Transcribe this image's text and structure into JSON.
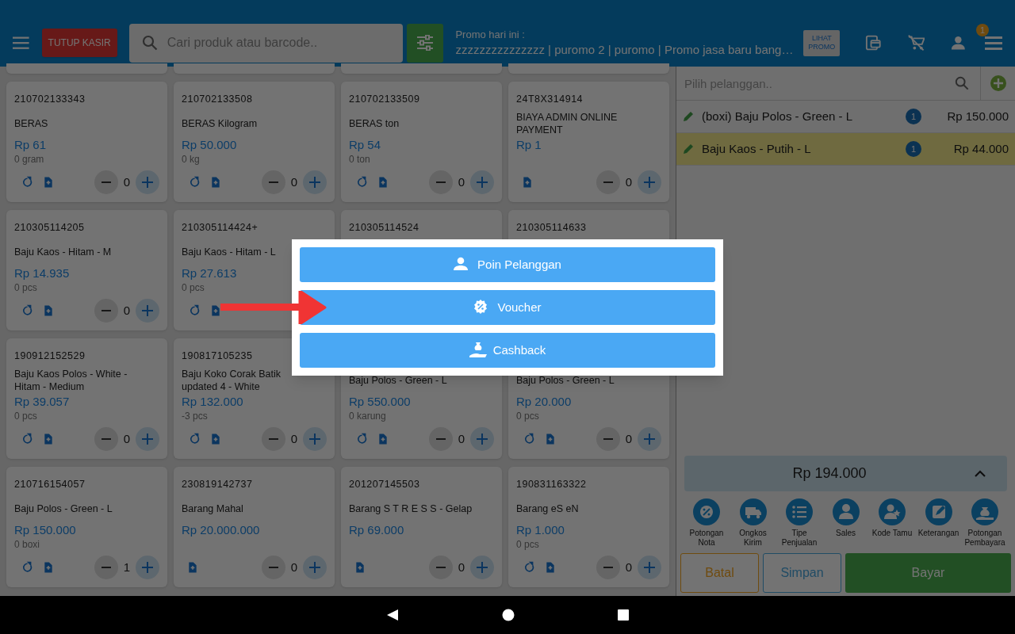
{
  "header": {
    "cashier_button": "TUTUP KASIR",
    "search": {
      "placeholder": "Cari produk atau barcode.."
    },
    "promo_label": "Promo hari ini :",
    "promo_text": "zzzzzzzzzzzzzzz | puromo 2 | puromo | Promo jasa baru bang…",
    "promo_button": "LIHAT PROMO",
    "notification_count": "1"
  },
  "products": [
    {
      "code": "210702133343",
      "name": "BERAS",
      "price": "Rp 61",
      "stock": "0 gram",
      "qty": "0",
      "refresh": true
    },
    {
      "code": "210702133508",
      "name": "BERAS Kilogram",
      "price": "Rp 50.000",
      "stock": "0 kg",
      "qty": "0",
      "refresh": true
    },
    {
      "code": "210702133509",
      "name": "BERAS ton",
      "price": "Rp 54",
      "stock": "0 ton",
      "qty": "0",
      "refresh": true
    },
    {
      "code": "24T8X314914",
      "name": "BIAYA ADMIN ONLINE PAYMENT",
      "price": "Rp 1",
      "qty": "0",
      "refresh": false
    },
    {
      "code": "210305114205",
      "name": "Baju Kaos - Hitam - M",
      "price": "Rp 14.935",
      "stock": "0 pcs",
      "qty": "0",
      "refresh": true
    },
    {
      "code": "210305114424+",
      "name": "Baju Kaos - Hitam - L",
      "price": "Rp 27.613",
      "stock": "0 pcs",
      "refresh": true
    },
    {
      "code": "210305114524"
    },
    {
      "code": "210305114633"
    },
    {
      "code": "190912152529",
      "name": "Baju Kaos Polos - White - Hitam - Medium",
      "price": "Rp 39.057",
      "stock": "0 pcs",
      "qty": "0",
      "refresh": true
    },
    {
      "code": "190817105235",
      "name": "Baju Koko Corak Batik updated 4 - White",
      "price": "Rp 132.000",
      "stock": "-3 pcs",
      "qty": "0",
      "refresh": true
    },
    {
      "name": "Baju Polos - Green - L",
      "price": "Rp 550.000",
      "stock": "0 karung",
      "qty": "0",
      "refresh": true
    },
    {
      "name": "Baju Polos - Green - L",
      "price": "Rp 20.000",
      "stock": "0 pcs",
      "qty": "0",
      "refresh": true
    },
    {
      "code": "210716154057",
      "name": "Baju Polos - Green - L",
      "price": "Rp 150.000",
      "stock": "0 boxi",
      "qty": "1",
      "refresh": true
    },
    {
      "code": "230819142737",
      "name": "Barang Mahal",
      "price": "Rp 20.000.000",
      "qty": "0",
      "refresh": false
    },
    {
      "code": "201207145503",
      "name": "Barang S T R E S S - Gelap",
      "price": "Rp 69.000",
      "qty": "0",
      "refresh": false
    },
    {
      "code": "190831163322",
      "name": "Barang eS eN",
      "price": "Rp 1.000",
      "stock": "0 pcs",
      "qty": "0",
      "refresh": true
    }
  ],
  "customer": {
    "placeholder": "Pilih pelanggan.."
  },
  "cart": [
    {
      "name": "(boxi) Baju Polos - Green - L",
      "qty": "1",
      "price": "Rp 150.000",
      "selected": false
    },
    {
      "name": "Baju Kaos - Putih - L",
      "qty": "1",
      "price": "Rp 44.000",
      "selected": true
    }
  ],
  "total": "Rp 194.000",
  "actions": [
    {
      "kind": "discount",
      "label": "Potongan Nota"
    },
    {
      "kind": "shipping",
      "label": "Ongkos Kirim"
    },
    {
      "kind": "list",
      "label": "Tipe Penjualan"
    },
    {
      "kind": "person",
      "label": "Sales"
    },
    {
      "kind": "guest",
      "label": "Kode Tamu"
    },
    {
      "kind": "note",
      "label": "Keterangan"
    },
    {
      "kind": "money",
      "label": "Potongan Pembayara"
    }
  ],
  "buttons": [
    {
      "kind": "cancel",
      "label": "Batal"
    },
    {
      "kind": "save",
      "label": "Simpan"
    },
    {
      "kind": "pay",
      "label": "Bayar"
    }
  ],
  "dialog": {
    "options": [
      {
        "kind": "points",
        "label": "Poin Pelanggan"
      },
      {
        "kind": "voucher",
        "label": "Voucher"
      },
      {
        "kind": "cashback",
        "label": "Cashback"
      }
    ]
  }
}
